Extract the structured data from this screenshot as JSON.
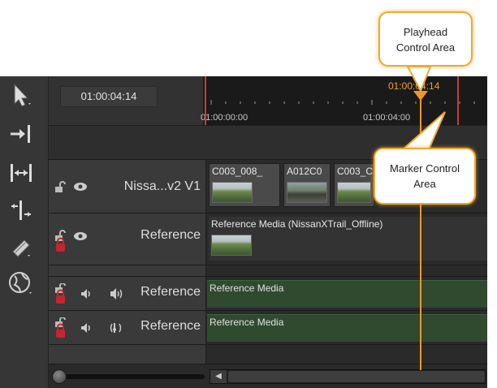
{
  "header": {
    "timecode": "01:00:04:14",
    "ruler": {
      "start_label": "01:00:00:00",
      "mid_label": "01:00:04:00",
      "playhead_label": "01:00:04:14"
    }
  },
  "tools": [
    {
      "icon": "select-arrow-icon"
    },
    {
      "icon": "track-forward-icon"
    },
    {
      "icon": "slip-icon"
    },
    {
      "icon": "trim-icon"
    },
    {
      "icon": "razor-icon"
    },
    {
      "icon": "globe-icon"
    }
  ],
  "tracks": {
    "video1": {
      "name": "Nissa...v2 V1",
      "clips": [
        "C003_008_",
        "A012C0",
        "C003_C"
      ]
    },
    "reference_video": {
      "name": "Reference",
      "clip_label": "Reference Media (NissanXTrail_Offline)"
    },
    "audio1": {
      "name": "Reference",
      "clip_label": "Reference Media"
    },
    "audio2": {
      "name": "Reference",
      "clip_label": "Reference Media"
    }
  },
  "callouts": {
    "playhead": [
      "Playhead",
      "Control Area"
    ],
    "marker": [
      "Marker Control",
      "Area"
    ]
  },
  "colors": {
    "playhead": "#f0962a",
    "in_out_marks": "#d13a2a",
    "callout_border": "#f0a830",
    "audio_clip": "#2f4a2f"
  }
}
